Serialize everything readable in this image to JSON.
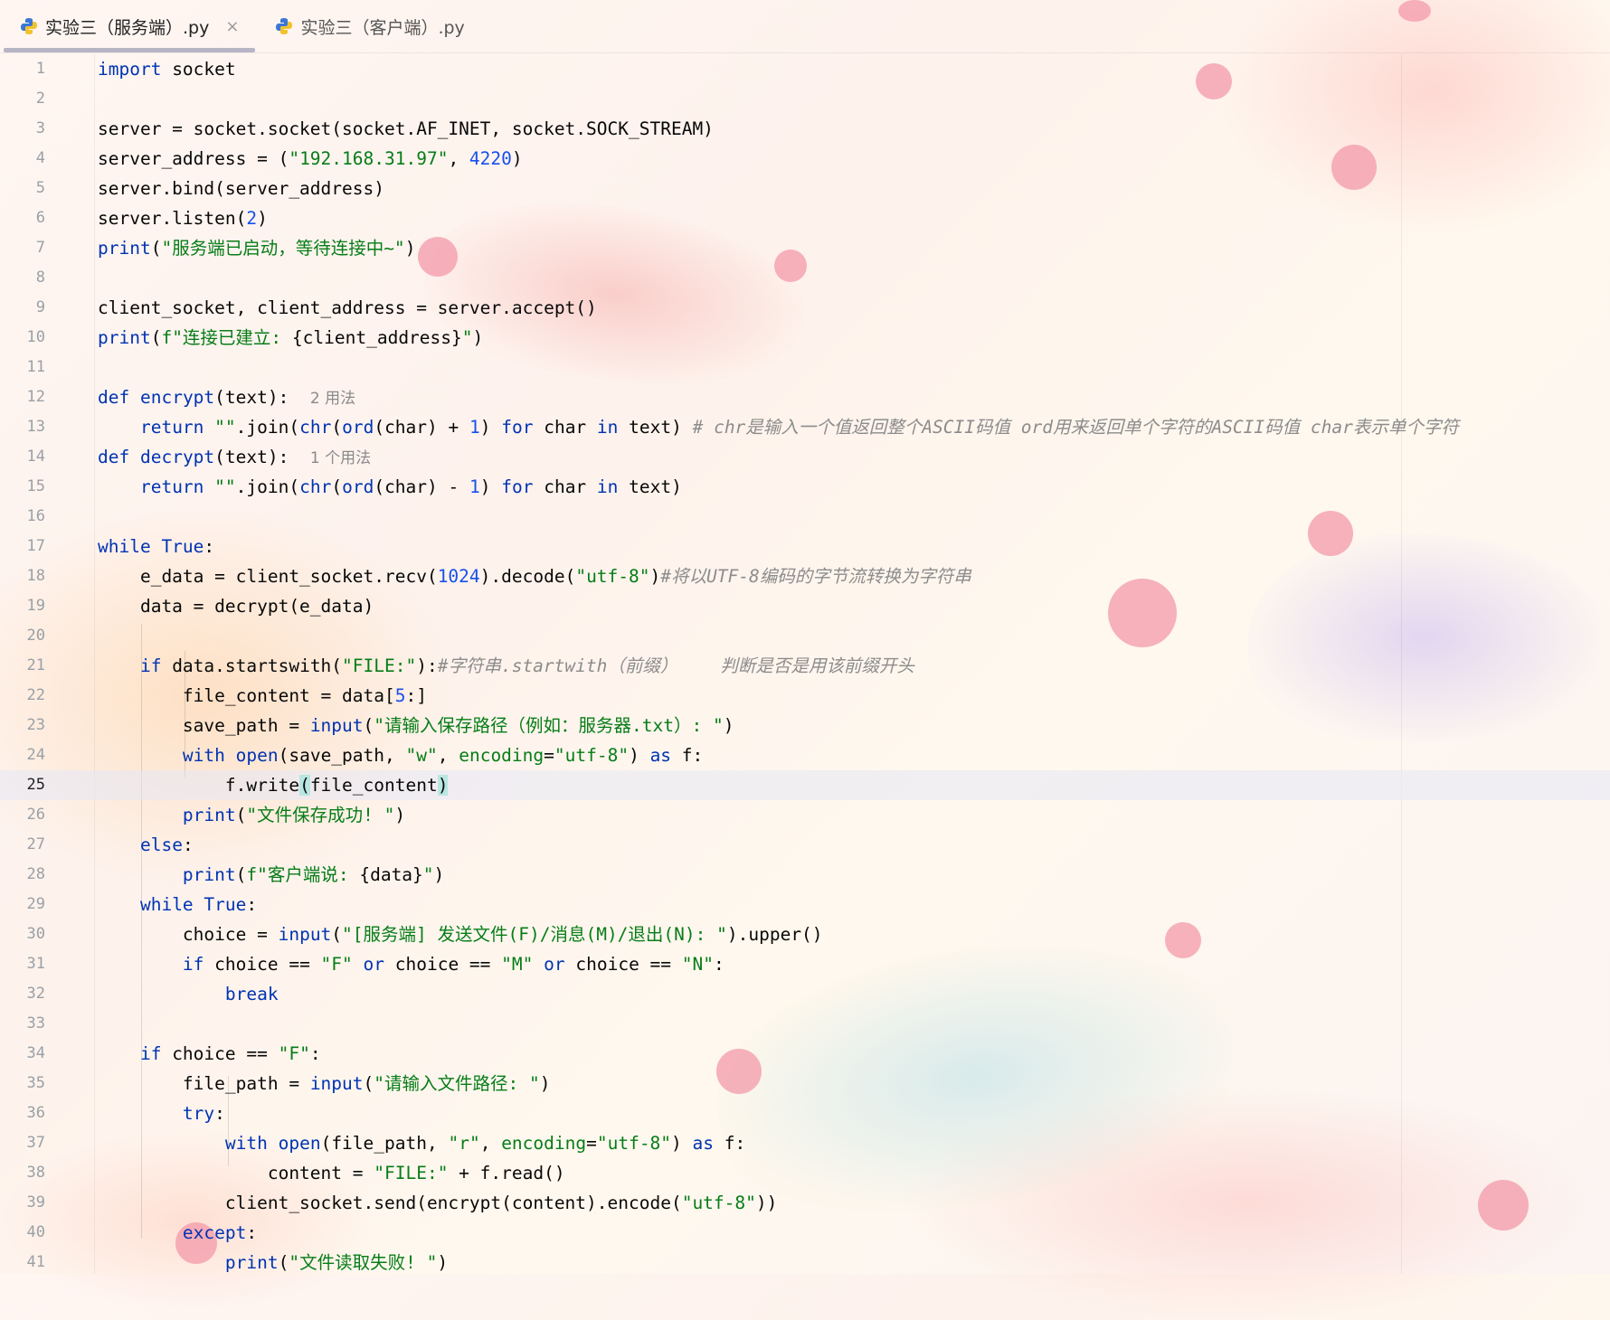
{
  "tabs": [
    {
      "label": "实验三（服务端）.py",
      "active": true,
      "close": "×"
    },
    {
      "label": "实验三（客户端）.py",
      "active": false
    }
  ],
  "current_line": 25,
  "lines": [
    {
      "n": "1",
      "t": "<span class=\"kw\">import</span> socket"
    },
    {
      "n": "2",
      "t": ""
    },
    {
      "n": "3",
      "t": "server = socket.socket(socket.AF_INET, socket.SOCK_STREAM)"
    },
    {
      "n": "4",
      "t": "server_address = (<span class=\"str\">\"192.168.31.97\"</span>, <span class=\"num\">4220</span>)"
    },
    {
      "n": "5",
      "t": "server.bind(server_address)"
    },
    {
      "n": "6",
      "t": "server.listen(<span class=\"num\">2</span>)"
    },
    {
      "n": "7",
      "t": "<span class=\"kw\">print</span>(<span class=\"str\">\"服务端已启动，等待连接中~\"</span>)"
    },
    {
      "n": "8",
      "t": ""
    },
    {
      "n": "9",
      "t": "client_socket, client_address = server.accept()"
    },
    {
      "n": "10",
      "t": "<span class=\"kw\">print</span>(<span class=\"str\">f\"连接已建立: </span>{client_address}<span class=\"str\">\"</span>)"
    },
    {
      "n": "11",
      "t": ""
    },
    {
      "n": "12",
      "t": "<span class=\"kw\">def</span> <span class=\"kw\">encrypt</span>(text):  <span class=\"hint\">2 用法</span>"
    },
    {
      "n": "13",
      "t": "    <span class=\"kw\">return</span> <span class=\"str\">\"\"</span>.join(<span class=\"kw\">chr</span>(<span class=\"kw\">ord</span>(char) + <span class=\"num\">1</span>) <span class=\"kw\">for</span> char <span class=\"kw\">in</span> text) <span class=\"cm\"># chr是输入一个值返回整个ASCII码值 ord用来返回单个字符的ASCII码值 char表示单个字符</span>"
    },
    {
      "n": "14",
      "t": "<span class=\"kw\">def</span> <span class=\"kw\">decrypt</span>(text):  <span class=\"hint\">1 个用法</span>"
    },
    {
      "n": "15",
      "t": "    <span class=\"kw\">return</span> <span class=\"str\">\"\"</span>.join(<span class=\"kw\">chr</span>(<span class=\"kw\">ord</span>(char) - <span class=\"num\">1</span>) <span class=\"kw\">for</span> char <span class=\"kw\">in</span> text)"
    },
    {
      "n": "16",
      "t": ""
    },
    {
      "n": "17",
      "t": "<span class=\"kw\">while True</span>:"
    },
    {
      "n": "18",
      "t": "    e_data = client_socket.recv(<span class=\"num\">1024</span>).decode(<span class=\"str\">\"utf-8\"</span>)<span class=\"cm\">#将以UTF-8编码的字节流转换为字符串</span>"
    },
    {
      "n": "19",
      "t": "    data = decrypt(e_data)"
    },
    {
      "n": "20",
      "t": ""
    },
    {
      "n": "21",
      "t": "    <span class=\"kw\">if</span> data.startswith(<span class=\"str\">\"FILE:\"</span>):<span class=\"cm\">#字符串.startwith（前缀）    判断是否是用该前缀开头</span>"
    },
    {
      "n": "22",
      "t": "        file_content = data[<span class=\"num\">5</span>:]"
    },
    {
      "n": "23",
      "t": "        save_path = <span class=\"kw\">input</span>(<span class=\"str\">\"请输入保存路径（例如：服务器.txt）: \"</span>)"
    },
    {
      "n": "24",
      "t": "        <span class=\"kw\">with</span> <span class=\"kw\">open</span>(save_path, <span class=\"str\">\"w\"</span>, <span class=\"str\">encoding</span>=<span class=\"str\">\"utf-8\"</span>) <span class=\"kw\">as</span> f:"
    },
    {
      "n": "25",
      "t": "            f.write<span class=\"brk\">(</span>file_content<span class=\"brk\">)</span>"
    },
    {
      "n": "26",
      "t": "        <span class=\"kw\">print</span>(<span class=\"str\">\"文件保存成功! \"</span>)"
    },
    {
      "n": "27",
      "t": "    <span class=\"kw\">else</span>:"
    },
    {
      "n": "28",
      "t": "        <span class=\"kw\">print</span>(<span class=\"str\">f\"客户端说: </span>{data}<span class=\"str\">\"</span>)"
    },
    {
      "n": "29",
      "t": "    <span class=\"kw\">while True</span>:"
    },
    {
      "n": "30",
      "t": "        choice = <span class=\"kw\">input</span>(<span class=\"str\">\"[服务端] 发送文件(F)/消息(M)/退出(N): \"</span>).upper()"
    },
    {
      "n": "31",
      "t": "        <span class=\"kw\">if</span> choice == <span class=\"str\">\"F\"</span> <span class=\"kw\">or</span> choice == <span class=\"str\">\"M\"</span> <span class=\"kw\">or</span> choice == <span class=\"str\">\"N\"</span>:"
    },
    {
      "n": "32",
      "t": "            <span class=\"kw\">break</span>"
    },
    {
      "n": "33",
      "t": ""
    },
    {
      "n": "34",
      "t": "    <span class=\"kw\">if</span> choice == <span class=\"str\">\"F\"</span>:"
    },
    {
      "n": "35",
      "t": "        file_path = <span class=\"kw\">input</span>(<span class=\"str\">\"请输入文件路径: \"</span>)"
    },
    {
      "n": "36",
      "t": "        <span class=\"kw\">try</span>:"
    },
    {
      "n": "37",
      "t": "            <span class=\"kw\">with</span> <span class=\"kw\">open</span>(file_path, <span class=\"str\">\"r\"</span>, <span class=\"str\">encoding</span>=<span class=\"str\">\"utf-8\"</span>) <span class=\"kw\">as</span> f:"
    },
    {
      "n": "38",
      "t": "                content = <span class=\"str\">\"FILE:\"</span> + f.read()"
    },
    {
      "n": "39",
      "t": "            client_socket.send(encrypt(content).encode(<span class=\"str\">\"utf-8\"</span>))"
    },
    {
      "n": "40",
      "t": "        <span class=\"kw\">except</span>:"
    },
    {
      "n": "41",
      "t": "            <span class=\"kw\">print</span>(<span class=\"str\">\"文件读取失败! \"</span>)"
    }
  ],
  "colors": {
    "keyword": "#0033b3",
    "string": "#067d17",
    "number": "#1750eb",
    "comment": "#8c8c8c",
    "accent": "#b7b4c6"
  },
  "icons": {
    "file_icon": "python-icon",
    "close_icon": "close-icon"
  }
}
